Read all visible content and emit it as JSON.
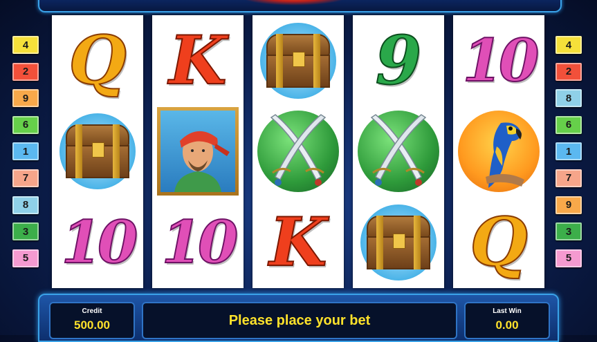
{
  "game": {
    "line_numbers_left": [
      {
        "n": "4",
        "color": "#f6e03a"
      },
      {
        "n": "2",
        "color": "#f2503a"
      },
      {
        "n": "9",
        "color": "#f8a84a"
      },
      {
        "n": "6",
        "color": "#66d04a"
      },
      {
        "n": "1",
        "color": "#5bb8f0"
      },
      {
        "n": "7",
        "color": "#f6a58a"
      },
      {
        "n": "8",
        "color": "#8fd0e8"
      },
      {
        "n": "3",
        "color": "#3cae4a"
      },
      {
        "n": "5",
        "color": "#f59ad0"
      }
    ],
    "line_numbers_right": [
      {
        "n": "4",
        "color": "#f6e03a"
      },
      {
        "n": "2",
        "color": "#f2503a"
      },
      {
        "n": "8",
        "color": "#8fd0e8"
      },
      {
        "n": "6",
        "color": "#66d04a"
      },
      {
        "n": "1",
        "color": "#5bb8f0"
      },
      {
        "n": "7",
        "color": "#f6a58a"
      },
      {
        "n": "9",
        "color": "#f8a84a"
      },
      {
        "n": "3",
        "color": "#3cae4a"
      },
      {
        "n": "5",
        "color": "#f59ad0"
      }
    ],
    "reels": [
      [
        "Q",
        "chest",
        "10"
      ],
      [
        "K",
        "pirate",
        "10"
      ],
      [
        "chest",
        "swords",
        "K"
      ],
      [
        "9",
        "swords",
        "chest"
      ],
      [
        "10",
        "parrot",
        "Q"
      ]
    ]
  },
  "panel": {
    "credit_label": "Credit",
    "credit_value": "500.00",
    "message": "Please place your bet",
    "last_win_label": "Last Win",
    "last_win_value": "0.00"
  }
}
